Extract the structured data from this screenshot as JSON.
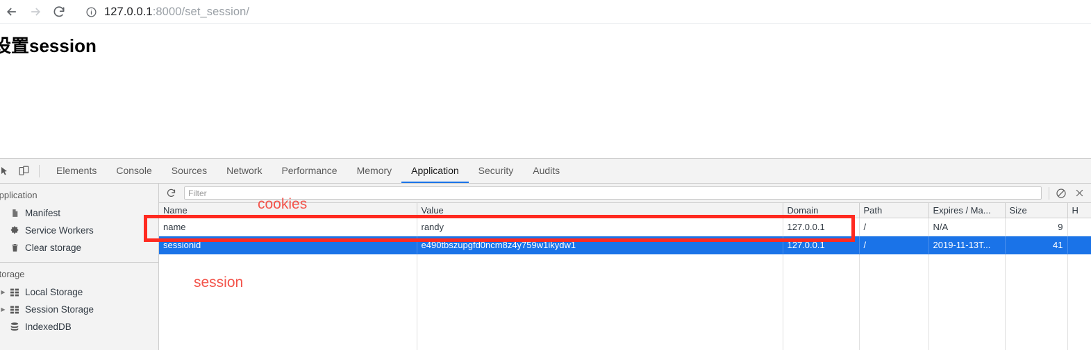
{
  "browser": {
    "back_label": "back-arrow",
    "forward_label": "forward-arrow",
    "reload_label": "reload",
    "site_info_label": "site-information",
    "url_host": "127.0.0.1",
    "url_path": ":8000/set_session/"
  },
  "page": {
    "heading": "设置session"
  },
  "devtools": {
    "tabs": [
      {
        "label": "Elements",
        "active": false
      },
      {
        "label": "Console",
        "active": false
      },
      {
        "label": "Sources",
        "active": false
      },
      {
        "label": "Network",
        "active": false
      },
      {
        "label": "Performance",
        "active": false
      },
      {
        "label": "Memory",
        "active": false
      },
      {
        "label": "Application",
        "active": true
      },
      {
        "label": "Security",
        "active": false
      },
      {
        "label": "Audits",
        "active": false
      }
    ],
    "sidebar": {
      "application_title": "Application",
      "application_items": [
        {
          "label": "Manifest",
          "icon": "document-icon"
        },
        {
          "label": "Service Workers",
          "icon": "gear-icon"
        },
        {
          "label": "Clear storage",
          "icon": "trash-icon"
        }
      ],
      "storage_title": "Storage",
      "storage_items": [
        {
          "label": "Local Storage",
          "icon": "grid-icon",
          "expandable": true
        },
        {
          "label": "Session Storage",
          "icon": "grid-icon",
          "expandable": true
        },
        {
          "label": "IndexedDB",
          "icon": "database-icon",
          "expandable": false
        }
      ]
    },
    "toolbar": {
      "refresh_label": "refresh",
      "filter_placeholder": "Filter",
      "filter_value": "",
      "clear_label": "clear-all-cookies",
      "close_label": "close"
    },
    "table": {
      "columns": [
        "Name",
        "Value",
        "Domain",
        "Path",
        "Expires / Ma...",
        "Size",
        "H"
      ],
      "rows": [
        {
          "name": "name",
          "value": "randy",
          "domain": "127.0.0.1",
          "path": "/",
          "expires": "N/A",
          "size": "9",
          "selected": false
        },
        {
          "name": "sessionid",
          "value": "e490tbszupgfd0ncm8z4y759w1ikydw1",
          "domain": "127.0.0.1",
          "path": "/",
          "expires": "2019-11-13T...",
          "size": "41",
          "selected": true
        }
      ]
    }
  },
  "annotations": {
    "cookies_label": "cookies",
    "session_label": "session",
    "color": "#ff2a20"
  }
}
